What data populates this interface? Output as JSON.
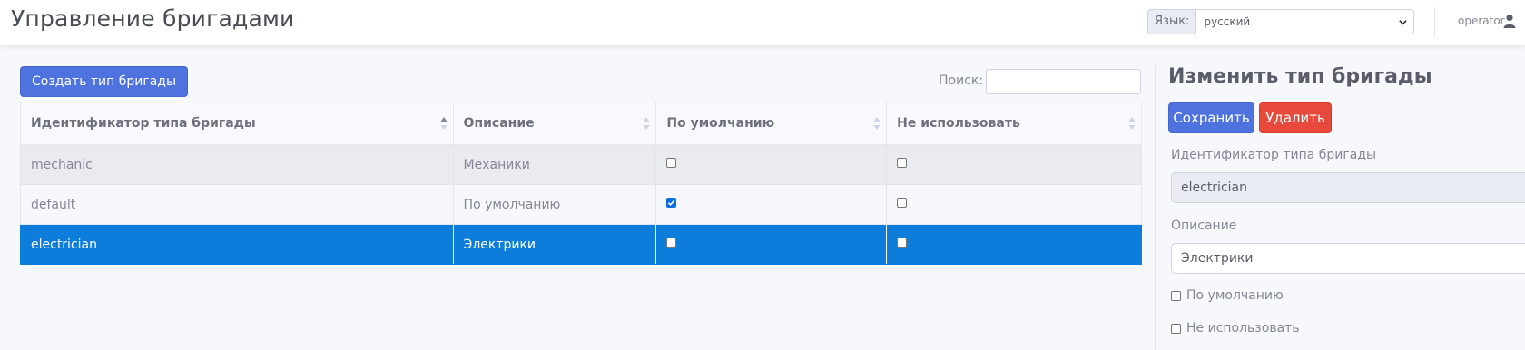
{
  "header": {
    "title": "Управление бригадами",
    "language_label": "Язык:",
    "language_value": "русский",
    "user_name": "operator"
  },
  "toolbar": {
    "create_label": "Создать тип бригады",
    "search_label": "Поиск:",
    "search_value": ""
  },
  "table": {
    "columns": [
      "Идентификатор типа бригады",
      "Описание",
      "По умолчанию",
      "Не использовать"
    ],
    "rows": [
      {
        "id": "mechanic",
        "description": "Механики",
        "is_default": false,
        "disabled": false,
        "selected": false
      },
      {
        "id": "default",
        "description": "По умолчанию",
        "is_default": true,
        "disabled": false,
        "selected": false
      },
      {
        "id": "electrician",
        "description": "Электрики",
        "is_default": false,
        "disabled": false,
        "selected": true
      }
    ]
  },
  "edit_panel": {
    "title": "Изменить тип бригады",
    "save_label": "Сохранить",
    "delete_label": "Удалить",
    "id_label": "Идентификатор типа бригады",
    "id_value": "electrician",
    "description_label": "Описание",
    "description_value": "Электрики",
    "default_label": "По умолчанию",
    "default_checked": false,
    "disabled_label": "Не использовать",
    "disabled_checked": false
  },
  "colors": {
    "primary": "#4e73df",
    "danger": "#e74a3b",
    "selected_row": "#0d7ddb"
  }
}
